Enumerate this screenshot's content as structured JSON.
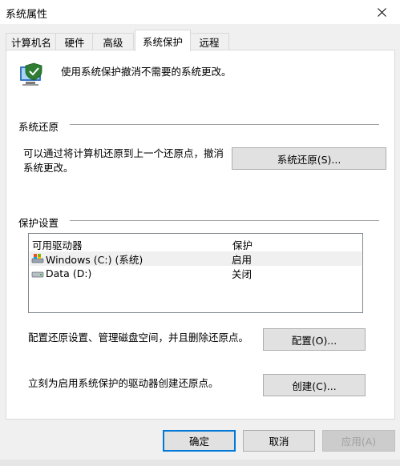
{
  "window": {
    "title": "系统属性",
    "close_label": "✕"
  },
  "tabs": [
    {
      "label": "计算机名",
      "active": false
    },
    {
      "label": "硬件",
      "active": false
    },
    {
      "label": "高级",
      "active": false
    },
    {
      "label": "系统保护",
      "active": true
    },
    {
      "label": "远程",
      "active": false
    }
  ],
  "header": {
    "text": "使用系统保护撤消不需要的系统更改。",
    "icon": "shield-computer-icon"
  },
  "system_restore": {
    "group_title": "系统还原",
    "description": "可以通过将计算机还原到上一个还原点，撤消系统更改。",
    "button_label": "系统还原(S)..."
  },
  "protection": {
    "group_title": "保护设置",
    "columns": [
      "可用驱动器",
      "保护"
    ],
    "drives": [
      {
        "name": "Windows (C:) (系统)",
        "status": "启用",
        "icon": "system-drive-icon",
        "selected": true
      },
      {
        "name": "Data (D:)",
        "status": "关闭",
        "icon": "drive-icon",
        "selected": false
      }
    ],
    "configure_text": "配置还原设置、管理磁盘空间，并且删除还原点。",
    "configure_button": "配置(O)...",
    "create_text": "立刻为启用系统保护的驱动器创建还原点。",
    "create_button": "创建(C)..."
  },
  "footer": {
    "ok": "确定",
    "cancel": "取消",
    "apply": "应用(A)"
  }
}
